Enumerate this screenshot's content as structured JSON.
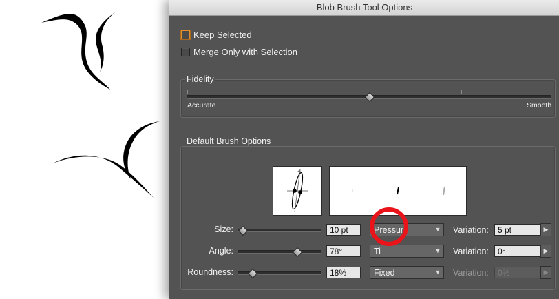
{
  "window": {
    "title": "Blob Brush Tool Options"
  },
  "options": {
    "keep_selected": {
      "label": "Keep Selected",
      "checked": false
    },
    "merge_only": {
      "label": "Merge Only with Selection",
      "checked": false
    }
  },
  "fidelity": {
    "legend": "Fidelity",
    "min_label": "Accurate",
    "max_label": "Smooth",
    "level_fraction": 0.5
  },
  "brush": {
    "legend": "Default Brush Options",
    "size": {
      "label": "Size:",
      "value": "10 pt",
      "level_fraction": 0.07,
      "mode": "Pressure",
      "variation_label": "Variation:",
      "variation_value": "5 pt"
    },
    "angle": {
      "label": "Angle:",
      "value": "78°",
      "level_fraction": 0.72,
      "mode": "Ti",
      "variation_label": "Variation:",
      "variation_value": "0°"
    },
    "roundness": {
      "label": "Roundness:",
      "value": "18%",
      "level_fraction": 0.18,
      "mode": "Fixed",
      "variation_label": "Variation:",
      "variation_value": "0%"
    }
  },
  "icons": {
    "dropdown": "triangle-down-icon",
    "spinner": "triangle-right-icon"
  },
  "colors": {
    "dialog_bg": "#535353",
    "annotation_circle": "#e8141a",
    "focus_ring": "#e1902b"
  }
}
